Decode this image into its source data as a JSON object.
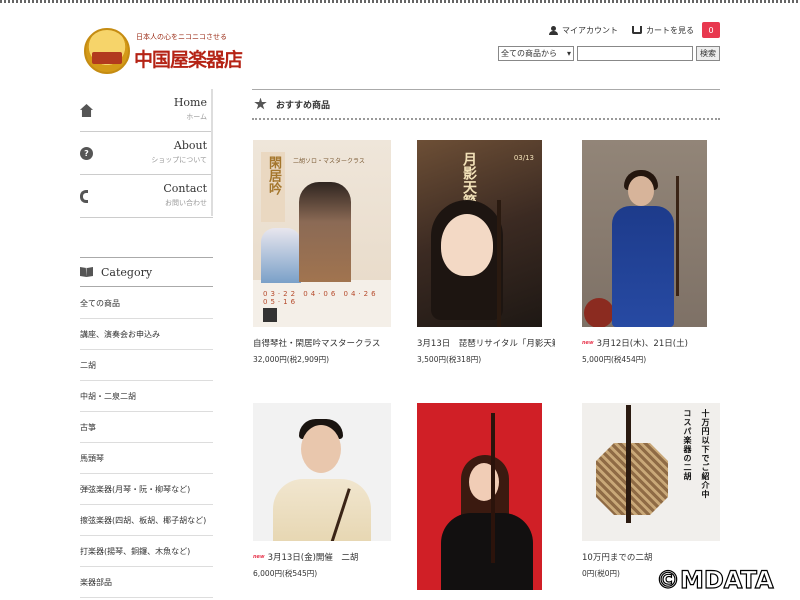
{
  "header": {
    "logo_sub": "日本人の心をニコニコさせる",
    "logo_main": "中国屋楽器店",
    "my_account": "マイアカウント",
    "view_cart": "カートを見る",
    "cart_count": "0"
  },
  "search": {
    "select_value": "全ての商品から",
    "input_value": "",
    "button_label": "検索"
  },
  "nav": [
    {
      "en": "Home",
      "jp": "ホーム",
      "icon": "home-icon"
    },
    {
      "en": "About",
      "jp": "ショップについて",
      "icon": "help-icon"
    },
    {
      "en": "Contact",
      "jp": "お問い合わせ",
      "icon": "phone-icon"
    }
  ],
  "category": {
    "title": "Category",
    "items": [
      "全ての商品",
      "講座、演奏会お申込み",
      "二胡",
      "中胡・二泉二胡",
      "古箏",
      "馬頭琴",
      "弾弦楽器(月琴・阮・柳琴など)",
      "擦弦楽器(四胡、板胡、椰子胡など)",
      "打楽器(揚琴、銅鑼、木魚など)",
      "楽器部品"
    ]
  },
  "section": {
    "title": "おすすめ商品"
  },
  "products": [
    {
      "name": "自得琴社・閑居吟マスタークラス",
      "price": "32,000円(税2,909円)",
      "new": "",
      "poster_title": "閑居吟",
      "poster_sub": "二胡ソロ・マスタークラス",
      "poster_dates": "03·22 04·06 04·26 05·16"
    },
    {
      "name": "3月13日　琵琶リサイタル「月影天籟」",
      "price": "3,500円(税318円)",
      "new": "",
      "poster_title": "月影天籟",
      "poster_date": "03/13"
    },
    {
      "name": "3月12日(木)、21日(土)",
      "price": "5,000円(税454円)",
      "new": "new"
    },
    {
      "name": "3月13日(金)開催　二胡",
      "price": "6,000円(税545円)",
      "new": "new"
    },
    {
      "name": "",
      "price": "",
      "new": ""
    },
    {
      "name": "10万円までの二胡",
      "price": "0円(税0円)",
      "new": "",
      "poster_col1": "十万円以下でご紹介中",
      "poster_col2": "コスパ楽器の二胡"
    }
  ],
  "watermark": "©MDATA"
}
